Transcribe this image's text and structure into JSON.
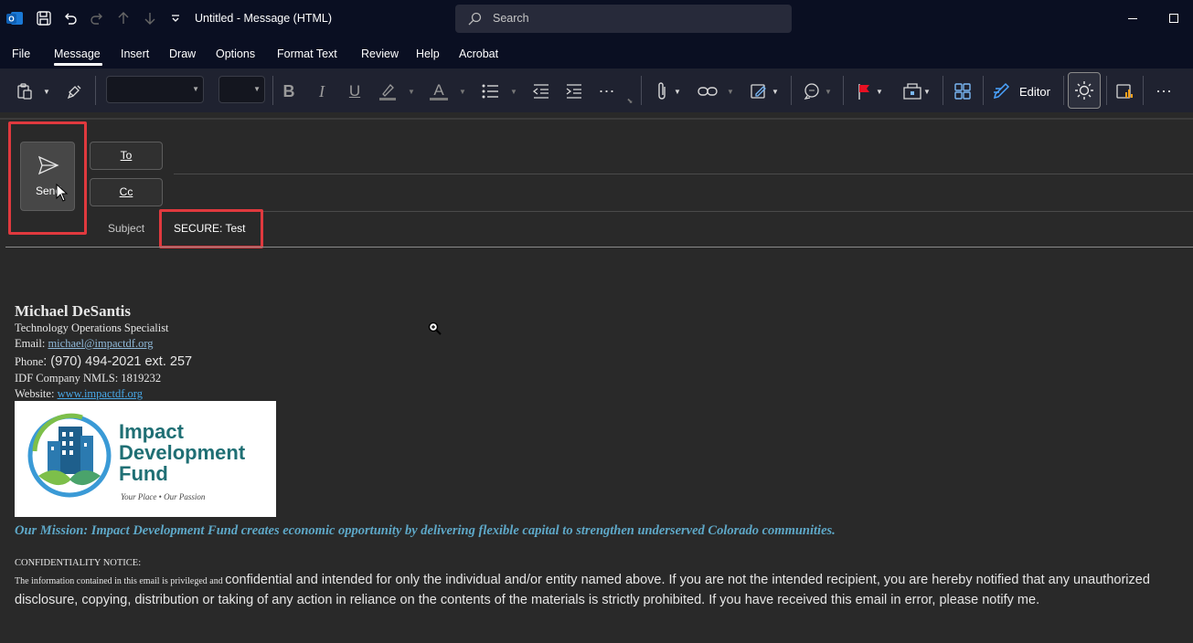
{
  "titlebar": {
    "title": "Untitled  -  Message (HTML)",
    "search_placeholder": "Search"
  },
  "menu": {
    "items": [
      "File",
      "Message",
      "Insert",
      "Draw",
      "Options",
      "Format Text",
      "Review",
      "Help",
      "Acrobat"
    ],
    "active": "Message"
  },
  "ribbon": {
    "editor_label": "Editor",
    "bold": "B",
    "italic": "I",
    "underline": "U",
    "font_color": "A"
  },
  "compose": {
    "send_label": "Send",
    "to_label": "To",
    "cc_label": "Cc",
    "subject_label": "Subject",
    "subject_value": "SECURE: Test"
  },
  "signature": {
    "name": "Michael DeSantis",
    "title": "Technology Operations Specialist",
    "email_label": "Email: ",
    "email": "michael@impactdf.org",
    "phone_label": "Phone",
    "phone": ": (970) 494-2021 ext. 257",
    "nmls": "IDF Company NMLS: 1819232",
    "website_label": "Website: ",
    "website": "www.impactdf.org",
    "logo": {
      "line1": "Impact",
      "line2": "Development",
      "line3": "Fund",
      "tagline": "Your Place • Our Passion",
      "text_color": "#1f6f74"
    },
    "mission": "Our Mission: Impact Development Fund creates economic opportunity by delivering flexible capital to strengthen underserved Colorado communities.",
    "notice_title": "CONFIDENTIALITY NOTICE:",
    "notice_small": "The information contained in this email is privileged and ",
    "notice_large": "confidential and intended for only the individual and/or entity named above. If you are not the intended recipient, you are hereby notified that any unauthorized disclosure, copying, distribution or taking of any action in reliance on the contents of the materials is strictly prohibited. If you have received this email in error, please notify me."
  },
  "colors": {
    "titlebar_bg": "#0a0f22",
    "ribbon_bg": "#1f2230",
    "compose_bg": "#292929",
    "highlight_red": "#e0393e",
    "link": "#48a7e6",
    "mission": "#5ea8c8",
    "flag_red": "#e81123"
  }
}
